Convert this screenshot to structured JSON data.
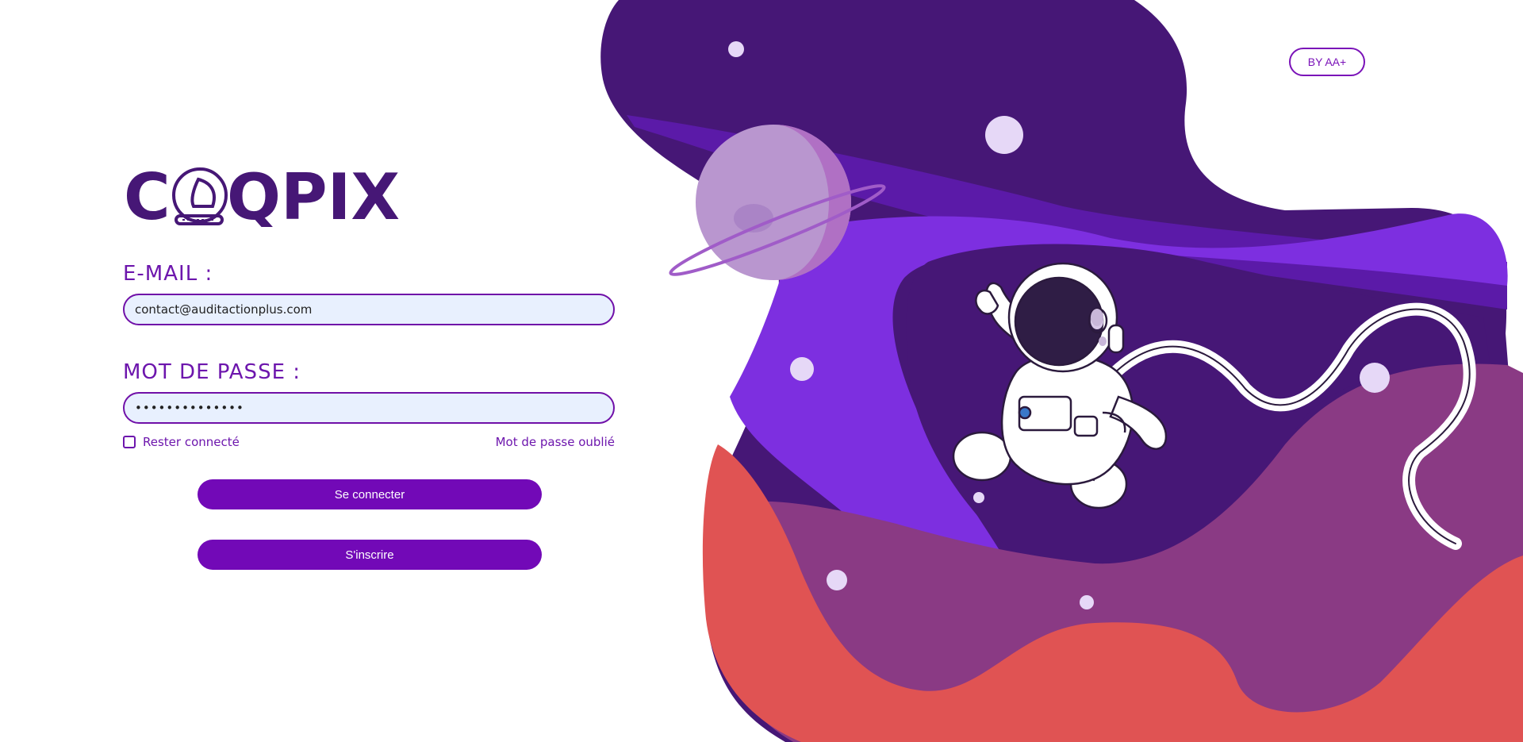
{
  "brand": {
    "logo_text": "COQPIX",
    "badge": "BY AA+"
  },
  "colors": {
    "primary": "#7209b7",
    "label": "#6d16ad",
    "input_bg": "#e8f0fe",
    "space_dark": "#461776",
    "space_mid": "#6a1fc0",
    "space_bright": "#7d2fe0",
    "mauve": "#8a3a84",
    "coral": "#e05353"
  },
  "form": {
    "email_label": "E-MAIL :",
    "email_value": "contact@auditactionplus.com",
    "password_label": "MOT DE PASSE :",
    "password_value": "••••••••••••••",
    "remember_label": "Rester connecté",
    "forgot_label": "Mot de passe oublié",
    "login_button": "Se connecter",
    "signup_button": "S'inscrire"
  },
  "illustration": {
    "icons": [
      "astronaut-icon",
      "planet-icon",
      "star-dot-icon"
    ]
  }
}
